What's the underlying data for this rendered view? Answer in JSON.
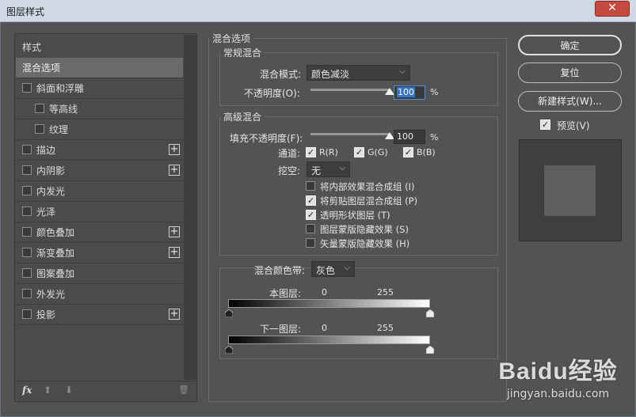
{
  "window": {
    "title": "图层样式",
    "close_glyph": "✕"
  },
  "sidebar": {
    "header": "样式",
    "items": [
      {
        "label": "混合选项",
        "checkbox": false,
        "plus": false,
        "selected": true
      },
      {
        "label": "斜面和浮雕",
        "checkbox": true,
        "plus": false
      },
      {
        "label": "等高线",
        "checkbox": true,
        "plus": false,
        "indent": true
      },
      {
        "label": "纹理",
        "checkbox": true,
        "plus": false,
        "indent": true
      },
      {
        "label": "描边",
        "checkbox": true,
        "plus": true
      },
      {
        "label": "内阴影",
        "checkbox": true,
        "plus": true
      },
      {
        "label": "内发光",
        "checkbox": true,
        "plus": false
      },
      {
        "label": "光泽",
        "checkbox": true,
        "plus": false
      },
      {
        "label": "颜色叠加",
        "checkbox": true,
        "plus": true
      },
      {
        "label": "渐变叠加",
        "checkbox": true,
        "plus": true
      },
      {
        "label": "图案叠加",
        "checkbox": true,
        "plus": false
      },
      {
        "label": "外发光",
        "checkbox": true,
        "plus": false
      },
      {
        "label": "投影",
        "checkbox": true,
        "plus": true
      }
    ],
    "footer": {
      "fx": "fx",
      "up": "⬆",
      "down": "⬇",
      "trash": "🗑"
    }
  },
  "blend_options": {
    "section_title": "混合选项",
    "general": {
      "title": "常规混合",
      "mode_label": "混合模式:",
      "mode_value": "颜色减淡",
      "opacity_label": "不透明度(O):",
      "opacity_value": "100",
      "pct": "%",
      "opacity_level": 1.0
    },
    "advanced": {
      "title": "高级混合",
      "fill_label": "填充不透明度(F):",
      "fill_value": "100",
      "pct": "%",
      "fill_level": 1.0,
      "channels_label": "通道:",
      "channels": [
        {
          "label": "R(R)",
          "checked": true
        },
        {
          "label": "G(G)",
          "checked": true
        },
        {
          "label": "B(B)",
          "checked": true
        }
      ],
      "knockout_label": "挖空:",
      "knockout_value": "无",
      "options": [
        {
          "label": "将内部效果混合成组 (I)",
          "checked": false
        },
        {
          "label": "将剪贴图层混合成组 (P)",
          "checked": true
        },
        {
          "label": "透明形状图层 (T)",
          "checked": true
        },
        {
          "label": "图层蒙版隐藏效果 (S)",
          "checked": false
        },
        {
          "label": "矢量蒙版隐藏效果 (H)",
          "checked": false
        }
      ]
    },
    "blend_if": {
      "label": "混合颜色带:",
      "value": "灰色",
      "this_layer": {
        "label": "本图层:",
        "low": "0",
        "high": "255"
      },
      "underlying": {
        "label": "下一图层:",
        "low": "0",
        "high": "255"
      }
    }
  },
  "buttons": {
    "ok": "确定",
    "reset": "复位",
    "new_style": "新建样式(W)...",
    "preview_label": "预览(V)",
    "preview_checked": true
  },
  "watermark": {
    "brand": "Baidu经验",
    "url": "jingyan.baidu.com"
  }
}
